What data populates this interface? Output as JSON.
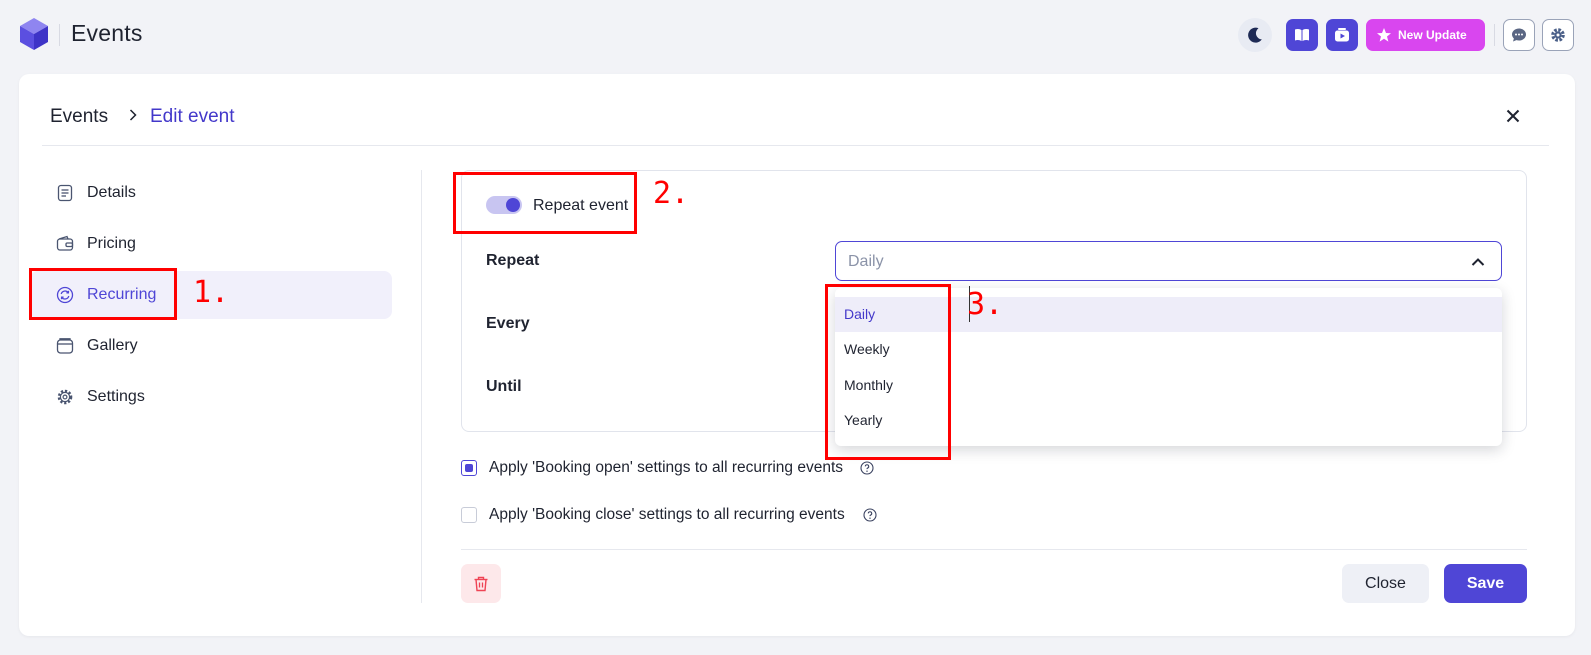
{
  "app": {
    "title": "Events"
  },
  "topbar": {
    "theme_icon": "moon-icon",
    "docs_icon": "book-icon",
    "video_icon": "video-icon",
    "update_label": "New Update",
    "chat_icon": "chat-icon",
    "settings_icon": "gear-icon"
  },
  "breadcrumb": {
    "root": "Events",
    "current": "Edit event"
  },
  "sidebar": {
    "items": [
      {
        "label": "Details",
        "icon": "document-icon"
      },
      {
        "label": "Pricing",
        "icon": "wallet-icon"
      },
      {
        "label": "Recurring",
        "icon": "refresh-icon",
        "active": true
      },
      {
        "label": "Gallery",
        "icon": "gallery-icon"
      },
      {
        "label": "Settings",
        "icon": "gear-icon"
      }
    ]
  },
  "form": {
    "repeat_toggle_label": "Repeat event",
    "repeat_toggle_on": true,
    "repeat_label": "Repeat",
    "repeat_value": "Daily",
    "every_label": "Every",
    "until_label": "Until",
    "dropdown_options": [
      "Daily",
      "Weekly",
      "Monthly",
      "Yearly"
    ],
    "dropdown_selected": "Daily",
    "checkboxes": [
      {
        "label": "Apply 'Booking open' settings to all recurring events",
        "checked": true
      },
      {
        "label": "Apply 'Booking close' settings to all recurring events",
        "checked": false
      }
    ]
  },
  "footer": {
    "close_label": "Close",
    "save_label": "Save"
  },
  "annotations": [
    "1.",
    "2.",
    "3."
  ],
  "colors": {
    "accent": "#4f46d6",
    "update": "#d946ef",
    "annotation": "#ff0000",
    "delete_bg": "#fde8ea"
  }
}
